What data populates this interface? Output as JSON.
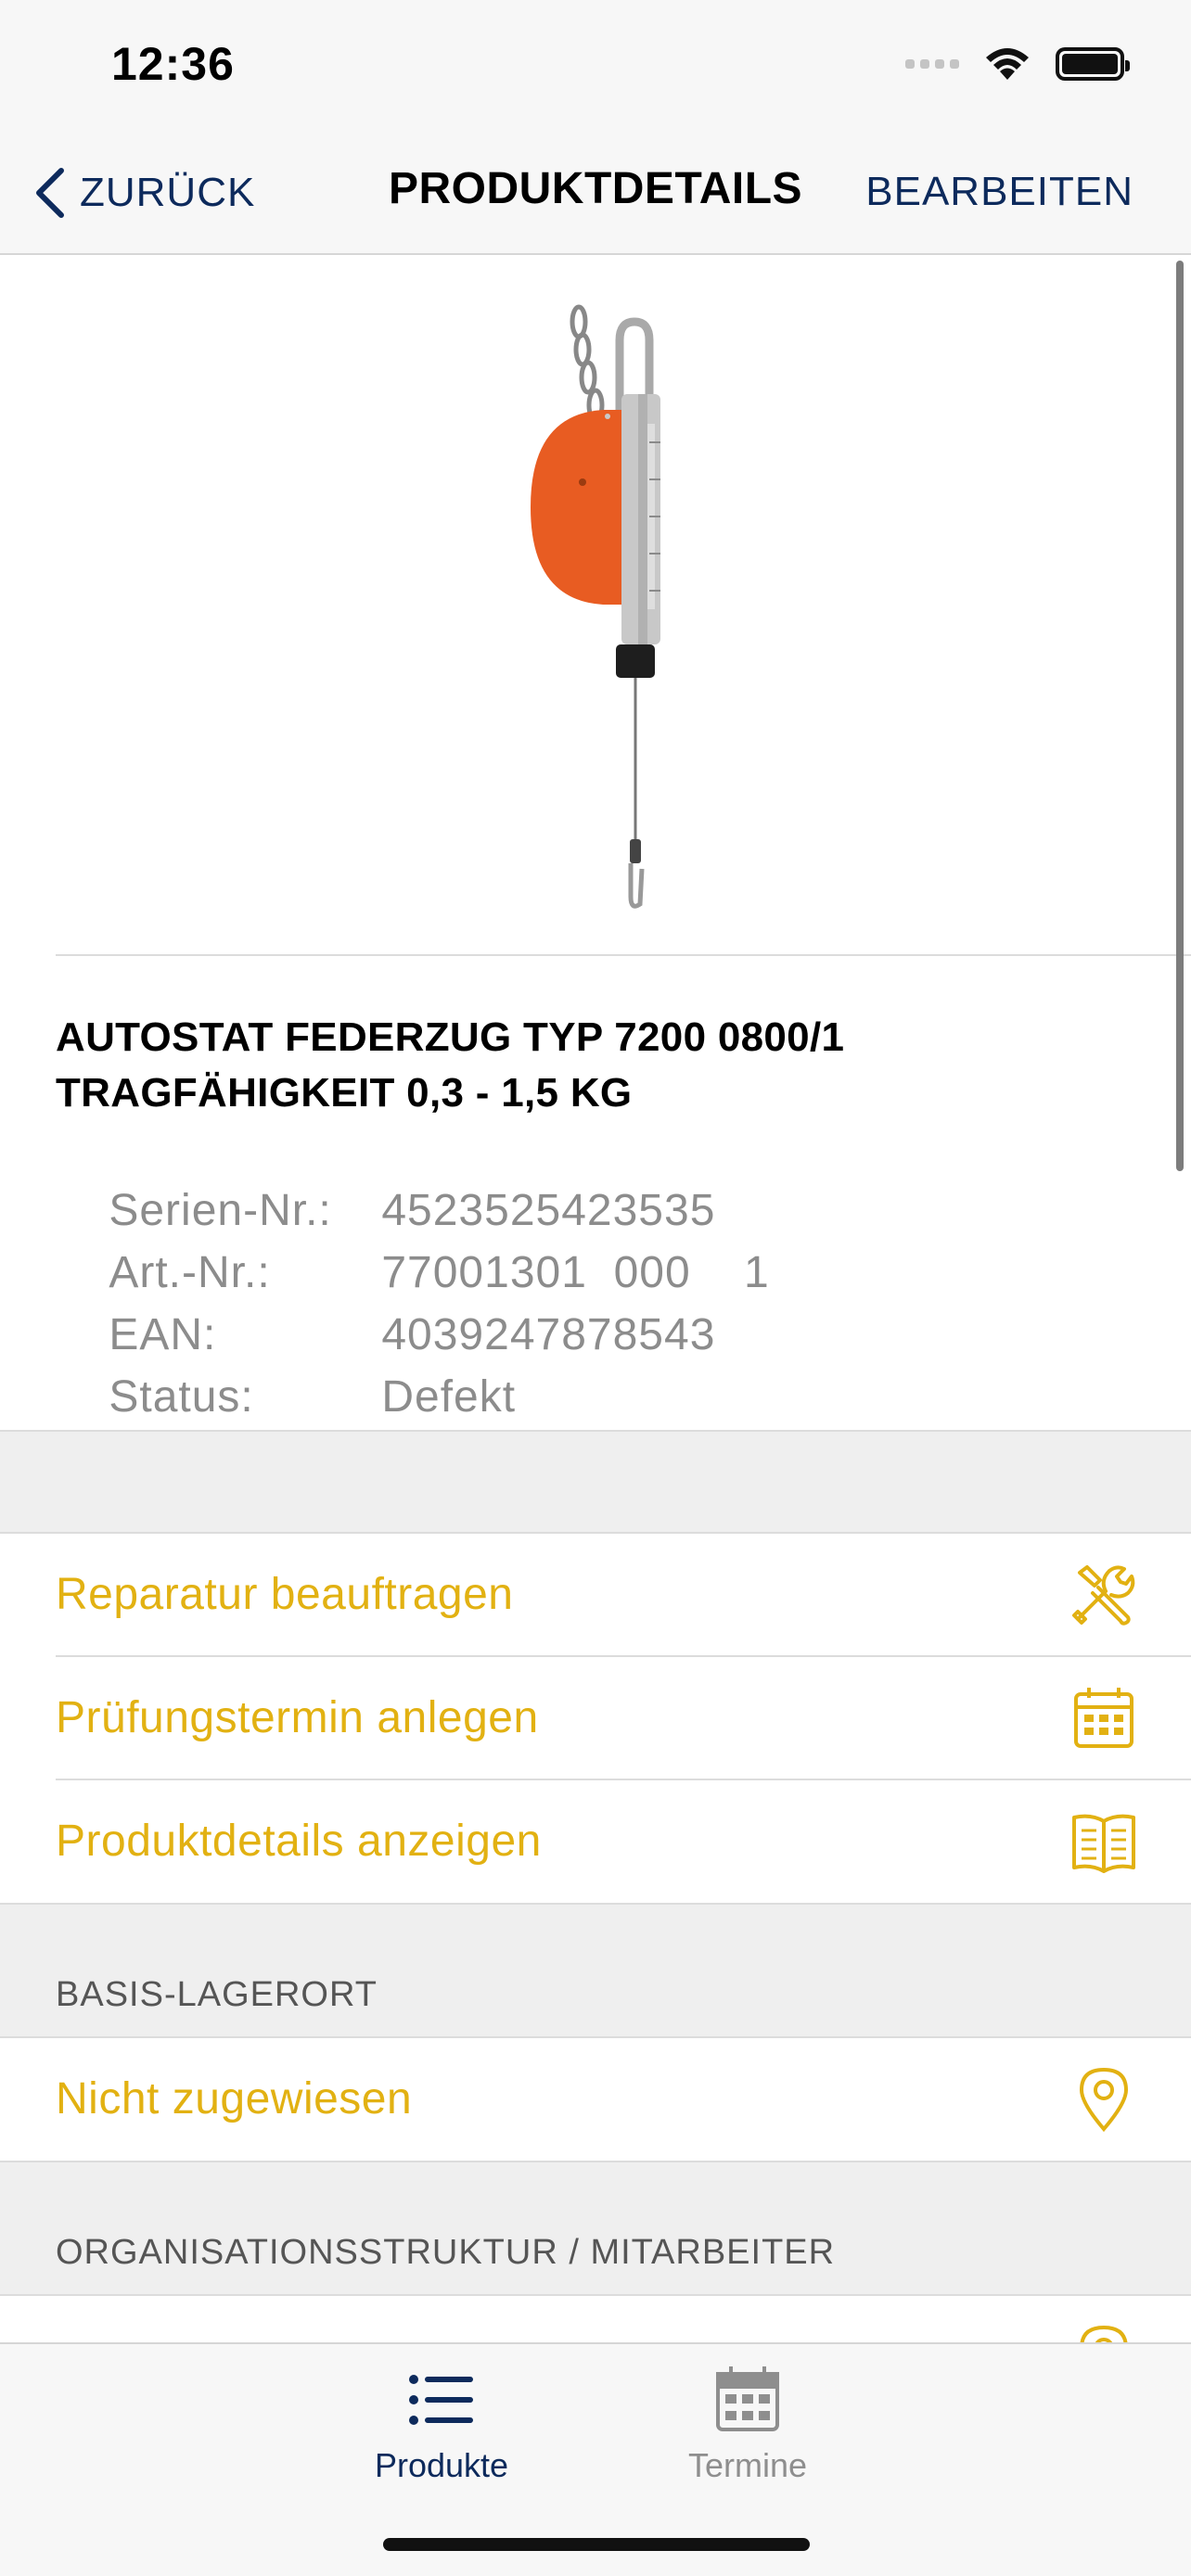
{
  "status_bar": {
    "time": "12:36"
  },
  "nav": {
    "back_label": "ZURÜCK",
    "title": "PRODUKTDETAILS",
    "edit_label": "BEARBEITEN"
  },
  "product": {
    "title": "AUTOSTAT FEDERZUG TYP 7200 0800/1 TRAGFÄHIGKEIT 0,3 - 1,5 KG",
    "info": [
      {
        "label": "Serien-Nr.:",
        "value": "4523525423535"
      },
      {
        "label": "Art.-Nr.:",
        "value": "77001301  000    1"
      },
      {
        "label": "EAN:",
        "value": "4039247878543"
      },
      {
        "label": "Status:",
        "value": "Defekt"
      }
    ]
  },
  "actions": [
    {
      "label": "Reparatur beauftragen",
      "icon": "tools-icon"
    },
    {
      "label": "Prüfungstermin anlegen",
      "icon": "calendar-icon"
    },
    {
      "label": "Produktdetails anzeigen",
      "icon": "book-icon"
    }
  ],
  "base_location": {
    "section_title": "BASIS-LAGERORT",
    "value": "Nicht zugewiesen",
    "icon": "location-pin-icon"
  },
  "org_structure": {
    "section_title": "ORGANISATIONSSTRUKTUR / MITARBEITER"
  },
  "tabs": [
    {
      "label": "Produkte",
      "icon": "list-icon",
      "active": true
    },
    {
      "label": "Termine",
      "icon": "calendar-icon",
      "active": false
    }
  ],
  "colors": {
    "primary": "#0d2a5c",
    "accent": "#e2b112",
    "product_orange": "#e85c22",
    "muted_text": "#8c8c8c"
  }
}
